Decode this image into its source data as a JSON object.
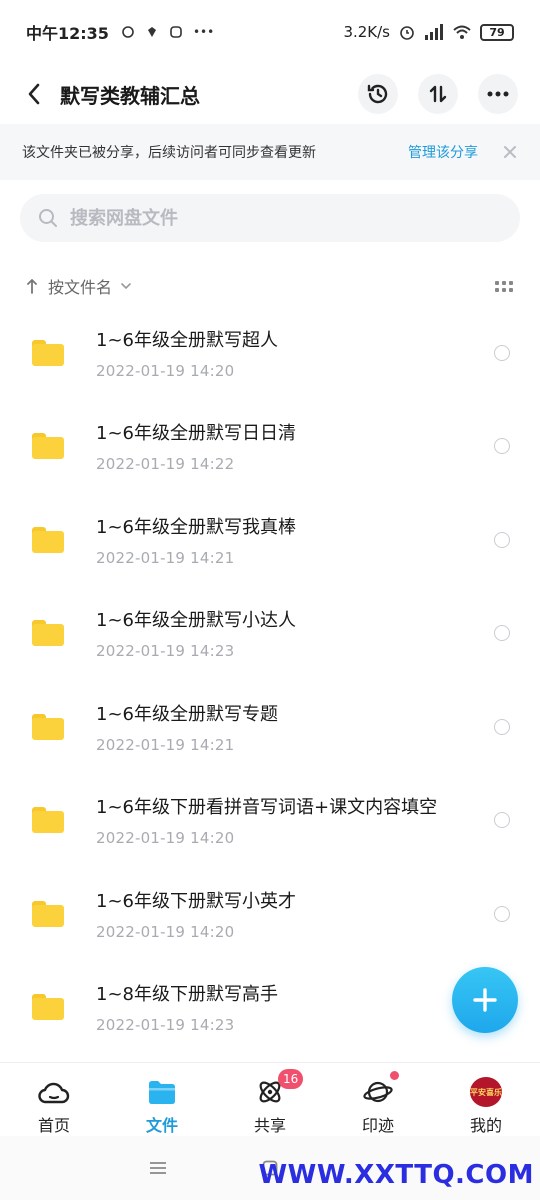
{
  "status_bar": {
    "time": "中午12:35",
    "network_speed": "3.2K/s",
    "battery": "79",
    "more": "•••"
  },
  "header": {
    "title": "默写类教辅汇总"
  },
  "banner": {
    "message": "该文件夹已被分享，后续访问者可同步查看更新",
    "manage_link": "管理该分享"
  },
  "search": {
    "placeholder": "搜索网盘文件"
  },
  "sort": {
    "label": "按文件名"
  },
  "files": [
    {
      "name": "1~6年级全册默写超人",
      "date": "2022-01-19  14:20"
    },
    {
      "name": "1~6年级全册默写日日清",
      "date": "2022-01-19  14:22"
    },
    {
      "name": "1~6年级全册默写我真棒",
      "date": "2022-01-19  14:21"
    },
    {
      "name": "1~6年级全册默写小达人",
      "date": "2022-01-19  14:23"
    },
    {
      "name": "1~6年级全册默写专题",
      "date": "2022-01-19  14:21"
    },
    {
      "name": "1~6年级下册看拼音写词语+课文内容填空",
      "date": "2022-01-19  14:20"
    },
    {
      "name": "1~6年级下册默写小英才",
      "date": "2022-01-19  14:20"
    },
    {
      "name": "1~8年级下册默写高手",
      "date": "2022-01-19  14:23"
    }
  ],
  "bottom_nav": [
    {
      "label": "首页"
    },
    {
      "label": "文件"
    },
    {
      "label": "共享",
      "badge": "16"
    },
    {
      "label": "印迹"
    },
    {
      "label": "我的",
      "avatar_text": "平安喜乐"
    }
  ],
  "watermark": "WWW.XXTTQ.COM",
  "colors": {
    "accent": "#1f9bd9",
    "folder": "#fbd23c",
    "badge": "#f0506e",
    "fab": "#1ea7ec"
  }
}
